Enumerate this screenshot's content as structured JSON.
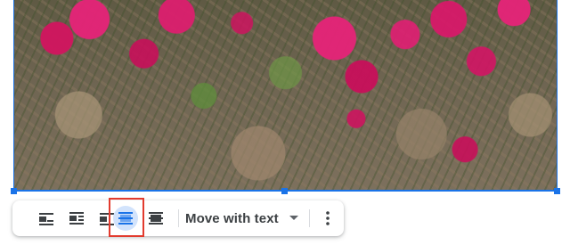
{
  "image": {
    "description_icon": "image-photo-icon"
  },
  "toolbar": {
    "buttons": [
      {
        "name": "inline-button",
        "icon": "wrap-inline-icon"
      },
      {
        "name": "wrap-text-button",
        "icon": "wrap-text-icon"
      },
      {
        "name": "break-text-button",
        "icon": "break-text-icon"
      },
      {
        "name": "behind-text-button",
        "icon": "behind-text-icon",
        "active": true
      },
      {
        "name": "in-front-of-text-button",
        "icon": "in-front-of-text-icon"
      }
    ],
    "position_dropdown": {
      "label": "Move with text"
    },
    "more_icon": "more-vert-icon"
  },
  "colors": {
    "selection": "#1a73e8",
    "active_bg": "#d2e3fc",
    "highlight": "#e23b2e",
    "icon": "#3c4043"
  }
}
